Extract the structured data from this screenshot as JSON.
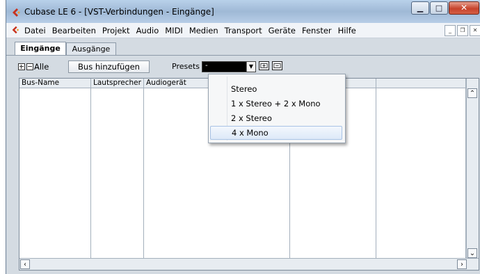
{
  "window": {
    "title": "Cubase LE 6 - [VST-Verbindungen - Eingänge]",
    "icon": "cubase-logo-icon",
    "controls": {
      "minimize": "minimize-icon",
      "maximize": "maximize-icon",
      "close": "close-icon"
    }
  },
  "menubar": {
    "items": [
      "Datei",
      "Bearbeiten",
      "Projekt",
      "Audio",
      "MIDI",
      "Medien",
      "Transport",
      "Geräte",
      "Fenster",
      "Hilfe"
    ],
    "mdi_controls": [
      "minimize",
      "restore",
      "close"
    ]
  },
  "tabs": [
    {
      "label": "Eingänge",
      "active": true
    },
    {
      "label": "Ausgänge",
      "active": false
    }
  ],
  "toolbar": {
    "expand_all": "Alle",
    "add_bus_label": "Bus hinzufügen",
    "presets_label": "Presets",
    "presets_value": "-",
    "icons": [
      "store-preset-icon",
      "remove-preset-icon"
    ]
  },
  "table": {
    "columns": [
      "Bus-Name",
      "Lautsprecher",
      "Audiogerät",
      "",
      "",
      ""
    ],
    "rows": []
  },
  "presets_dropdown": {
    "options": [
      "Stereo",
      "1 x Stereo + 2 x Mono",
      "2 x Stereo",
      "4 x Mono"
    ],
    "highlighted_index": 3
  },
  "colors": {
    "titlebar": "#b9d1ea",
    "window_bg": "#d4dbe2",
    "close_button": "#c7432c",
    "highlight": "#dde9f8"
  }
}
